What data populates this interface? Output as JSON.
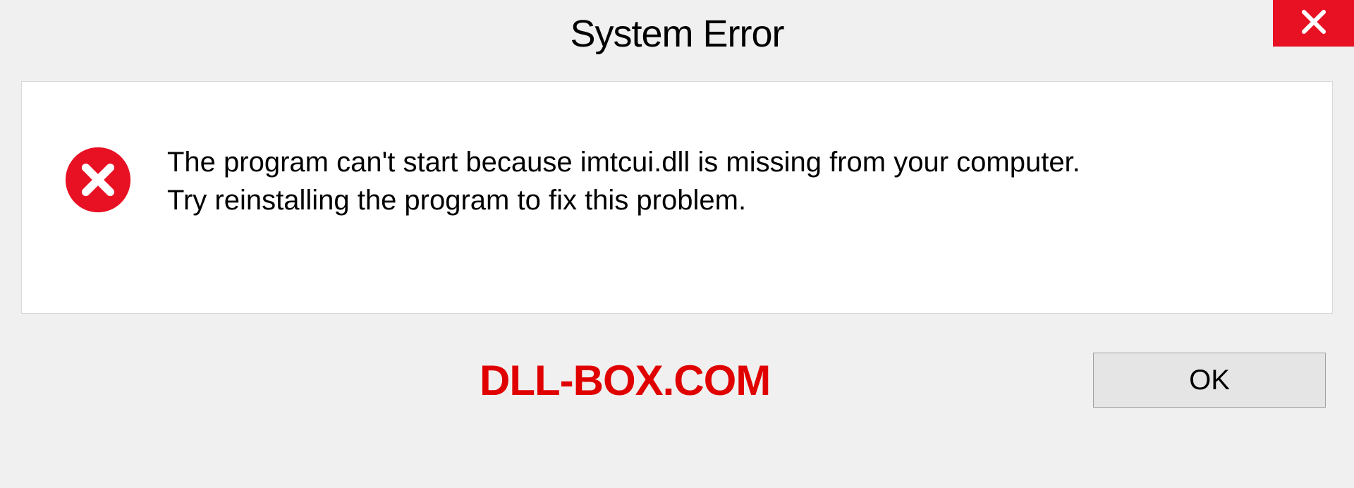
{
  "titlebar": {
    "title": "System Error"
  },
  "message": {
    "line1": "The program can't start because imtcui.dll is missing from your computer.",
    "line2": "Try reinstalling the program to fix this problem."
  },
  "footer": {
    "watermark": "DLL-BOX.COM",
    "ok_label": "OK"
  }
}
